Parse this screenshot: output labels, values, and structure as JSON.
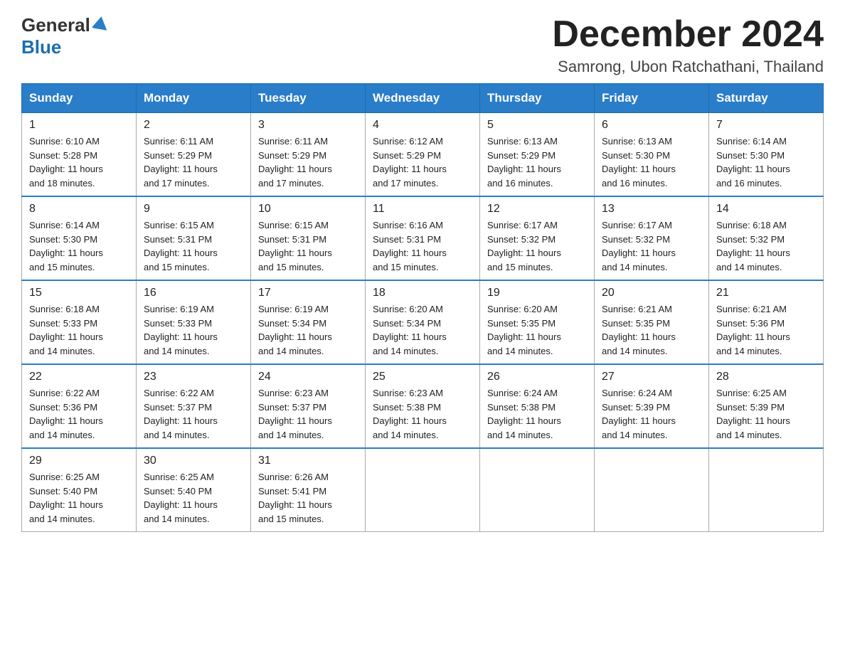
{
  "header": {
    "logo": {
      "line1": "General",
      "line2": "Blue"
    },
    "month_title": "December 2024",
    "location": "Samrong, Ubon Ratchathani, Thailand"
  },
  "weekdays": [
    "Sunday",
    "Monday",
    "Tuesday",
    "Wednesday",
    "Thursday",
    "Friday",
    "Saturday"
  ],
  "weeks": [
    [
      {
        "day": "1",
        "sunrise": "6:10 AM",
        "sunset": "5:28 PM",
        "daylight": "11 hours and 18 minutes."
      },
      {
        "day": "2",
        "sunrise": "6:11 AM",
        "sunset": "5:29 PM",
        "daylight": "11 hours and 17 minutes."
      },
      {
        "day": "3",
        "sunrise": "6:11 AM",
        "sunset": "5:29 PM",
        "daylight": "11 hours and 17 minutes."
      },
      {
        "day": "4",
        "sunrise": "6:12 AM",
        "sunset": "5:29 PM",
        "daylight": "11 hours and 17 minutes."
      },
      {
        "day": "5",
        "sunrise": "6:13 AM",
        "sunset": "5:29 PM",
        "daylight": "11 hours and 16 minutes."
      },
      {
        "day": "6",
        "sunrise": "6:13 AM",
        "sunset": "5:30 PM",
        "daylight": "11 hours and 16 minutes."
      },
      {
        "day": "7",
        "sunrise": "6:14 AM",
        "sunset": "5:30 PM",
        "daylight": "11 hours and 16 minutes."
      }
    ],
    [
      {
        "day": "8",
        "sunrise": "6:14 AM",
        "sunset": "5:30 PM",
        "daylight": "11 hours and 15 minutes."
      },
      {
        "day": "9",
        "sunrise": "6:15 AM",
        "sunset": "5:31 PM",
        "daylight": "11 hours and 15 minutes."
      },
      {
        "day": "10",
        "sunrise": "6:15 AM",
        "sunset": "5:31 PM",
        "daylight": "11 hours and 15 minutes."
      },
      {
        "day": "11",
        "sunrise": "6:16 AM",
        "sunset": "5:31 PM",
        "daylight": "11 hours and 15 minutes."
      },
      {
        "day": "12",
        "sunrise": "6:17 AM",
        "sunset": "5:32 PM",
        "daylight": "11 hours and 15 minutes."
      },
      {
        "day": "13",
        "sunrise": "6:17 AM",
        "sunset": "5:32 PM",
        "daylight": "11 hours and 14 minutes."
      },
      {
        "day": "14",
        "sunrise": "6:18 AM",
        "sunset": "5:32 PM",
        "daylight": "11 hours and 14 minutes."
      }
    ],
    [
      {
        "day": "15",
        "sunrise": "6:18 AM",
        "sunset": "5:33 PM",
        "daylight": "11 hours and 14 minutes."
      },
      {
        "day": "16",
        "sunrise": "6:19 AM",
        "sunset": "5:33 PM",
        "daylight": "11 hours and 14 minutes."
      },
      {
        "day": "17",
        "sunrise": "6:19 AM",
        "sunset": "5:34 PM",
        "daylight": "11 hours and 14 minutes."
      },
      {
        "day": "18",
        "sunrise": "6:20 AM",
        "sunset": "5:34 PM",
        "daylight": "11 hours and 14 minutes."
      },
      {
        "day": "19",
        "sunrise": "6:20 AM",
        "sunset": "5:35 PM",
        "daylight": "11 hours and 14 minutes."
      },
      {
        "day": "20",
        "sunrise": "6:21 AM",
        "sunset": "5:35 PM",
        "daylight": "11 hours and 14 minutes."
      },
      {
        "day": "21",
        "sunrise": "6:21 AM",
        "sunset": "5:36 PM",
        "daylight": "11 hours and 14 minutes."
      }
    ],
    [
      {
        "day": "22",
        "sunrise": "6:22 AM",
        "sunset": "5:36 PM",
        "daylight": "11 hours and 14 minutes."
      },
      {
        "day": "23",
        "sunrise": "6:22 AM",
        "sunset": "5:37 PM",
        "daylight": "11 hours and 14 minutes."
      },
      {
        "day": "24",
        "sunrise": "6:23 AM",
        "sunset": "5:37 PM",
        "daylight": "11 hours and 14 minutes."
      },
      {
        "day": "25",
        "sunrise": "6:23 AM",
        "sunset": "5:38 PM",
        "daylight": "11 hours and 14 minutes."
      },
      {
        "day": "26",
        "sunrise": "6:24 AM",
        "sunset": "5:38 PM",
        "daylight": "11 hours and 14 minutes."
      },
      {
        "day": "27",
        "sunrise": "6:24 AM",
        "sunset": "5:39 PM",
        "daylight": "11 hours and 14 minutes."
      },
      {
        "day": "28",
        "sunrise": "6:25 AM",
        "sunset": "5:39 PM",
        "daylight": "11 hours and 14 minutes."
      }
    ],
    [
      {
        "day": "29",
        "sunrise": "6:25 AM",
        "sunset": "5:40 PM",
        "daylight": "11 hours and 14 minutes."
      },
      {
        "day": "30",
        "sunrise": "6:25 AM",
        "sunset": "5:40 PM",
        "daylight": "11 hours and 14 minutes."
      },
      {
        "day": "31",
        "sunrise": "6:26 AM",
        "sunset": "5:41 PM",
        "daylight": "11 hours and 15 minutes."
      },
      null,
      null,
      null,
      null
    ]
  ],
  "labels": {
    "sunrise": "Sunrise:",
    "sunset": "Sunset:",
    "daylight": "Daylight:"
  }
}
